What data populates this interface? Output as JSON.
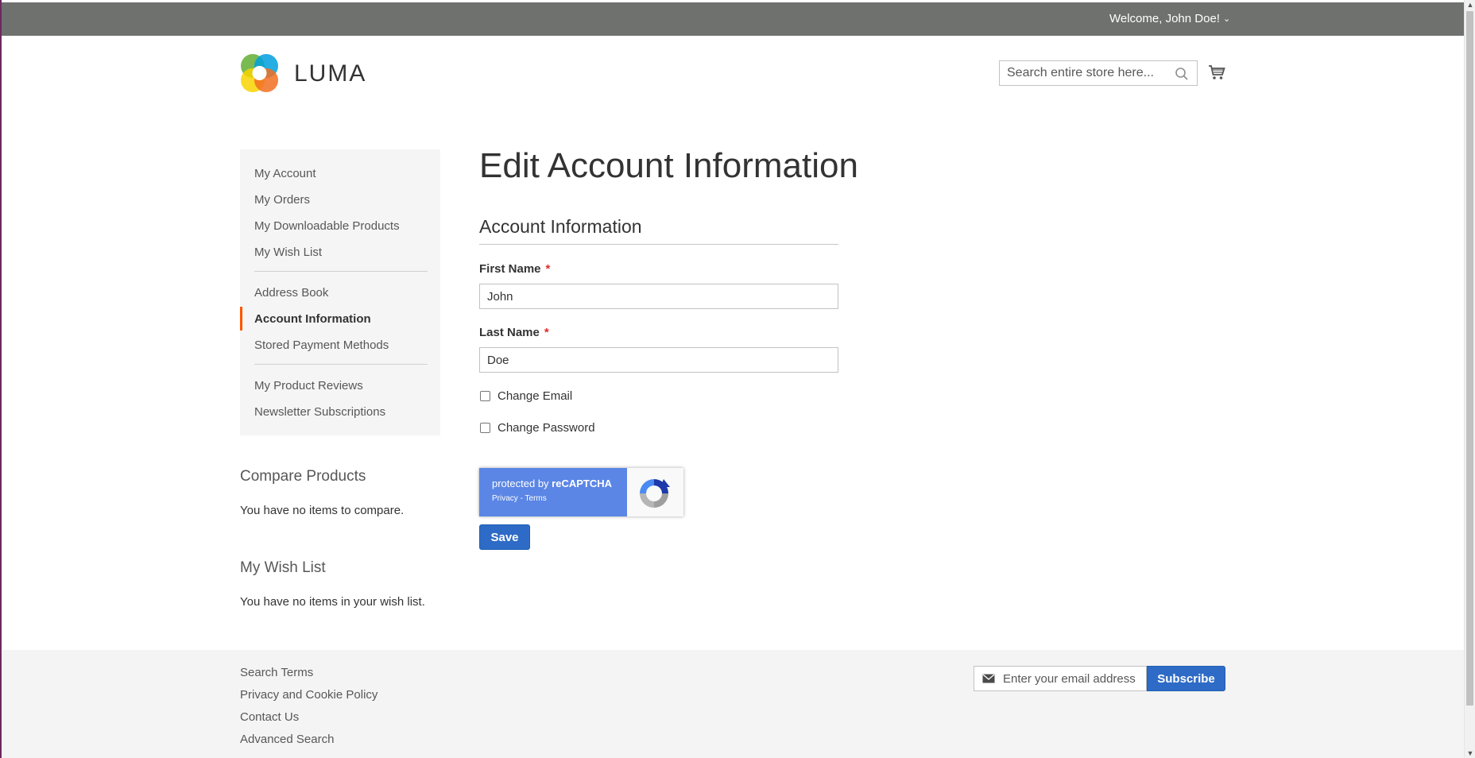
{
  "header": {
    "welcome": "Welcome, John Doe!",
    "logo_text": "LUMA",
    "search_placeholder": "Search entire store here..."
  },
  "sidebar": {
    "groups": [
      [
        {
          "label": "My Account"
        },
        {
          "label": "My Orders"
        },
        {
          "label": "My Downloadable Products"
        },
        {
          "label": "My Wish List"
        }
      ],
      [
        {
          "label": "Address Book"
        },
        {
          "label": "Account Information",
          "active": true
        },
        {
          "label": "Stored Payment Methods"
        }
      ],
      [
        {
          "label": "My Product Reviews"
        },
        {
          "label": "Newsletter Subscriptions"
        }
      ]
    ],
    "compare": {
      "title": "Compare Products",
      "text": "You have no items to compare."
    },
    "wishlist": {
      "title": "My Wish List",
      "text": "You have no items in your wish list."
    }
  },
  "main": {
    "title": "Edit Account Information",
    "section_title": "Account Information",
    "first_name": {
      "label": "First Name",
      "required_mark": "*",
      "value": "John"
    },
    "last_name": {
      "label": "Last Name",
      "required_mark": "*",
      "value": "Doe"
    },
    "change_email": {
      "label": "Change Email",
      "checked": false
    },
    "change_password": {
      "label": "Change Password",
      "checked": false
    },
    "recaptcha": {
      "protected_by": "protected by ",
      "brand": "reCAPTCHA",
      "privacy": "Privacy",
      "separator": " - ",
      "terms": "Terms"
    },
    "save_label": "Save"
  },
  "footer": {
    "links": [
      "Search Terms",
      "Privacy and Cookie Policy",
      "Contact Us",
      "Advanced Search"
    ],
    "newsletter_placeholder": "Enter your email address",
    "subscribe_label": "Subscribe"
  },
  "colors": {
    "top_panel": "#6e716e",
    "active_accent": "#ff5501",
    "button_blue": "#2e6bc6",
    "required": "#e02b27"
  }
}
